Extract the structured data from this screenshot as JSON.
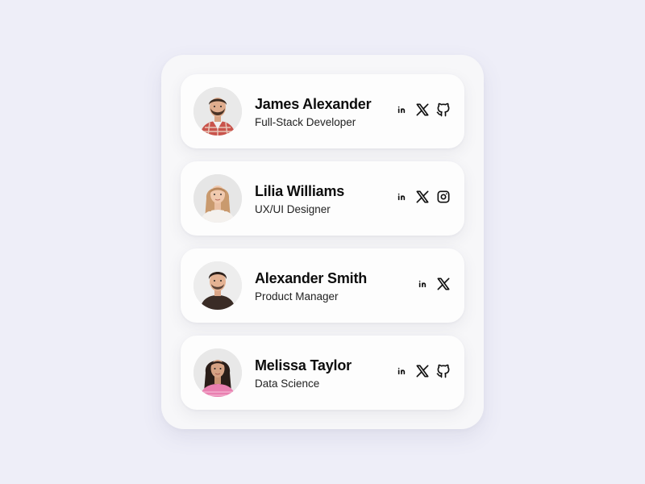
{
  "team": {
    "members": [
      {
        "name": "James Alexander",
        "role": "Full-Stack Developer",
        "socials": [
          "linkedin",
          "x",
          "github"
        ]
      },
      {
        "name": "Lilia Williams",
        "role": "UX/UI Designer",
        "socials": [
          "linkedin",
          "x",
          "instagram"
        ]
      },
      {
        "name": "Alexander Smith",
        "role": "Product Manager",
        "socials": [
          "linkedin",
          "x"
        ]
      },
      {
        "name": "Melissa Taylor",
        "role": "Data Science",
        "socials": [
          "linkedin",
          "x",
          "github"
        ]
      }
    ]
  },
  "colors": {
    "background": "#eeeef8",
    "panel": "#f7f7f9",
    "card": "#fdfdfd",
    "text": "#0d0d0d",
    "icon": "#111111"
  }
}
